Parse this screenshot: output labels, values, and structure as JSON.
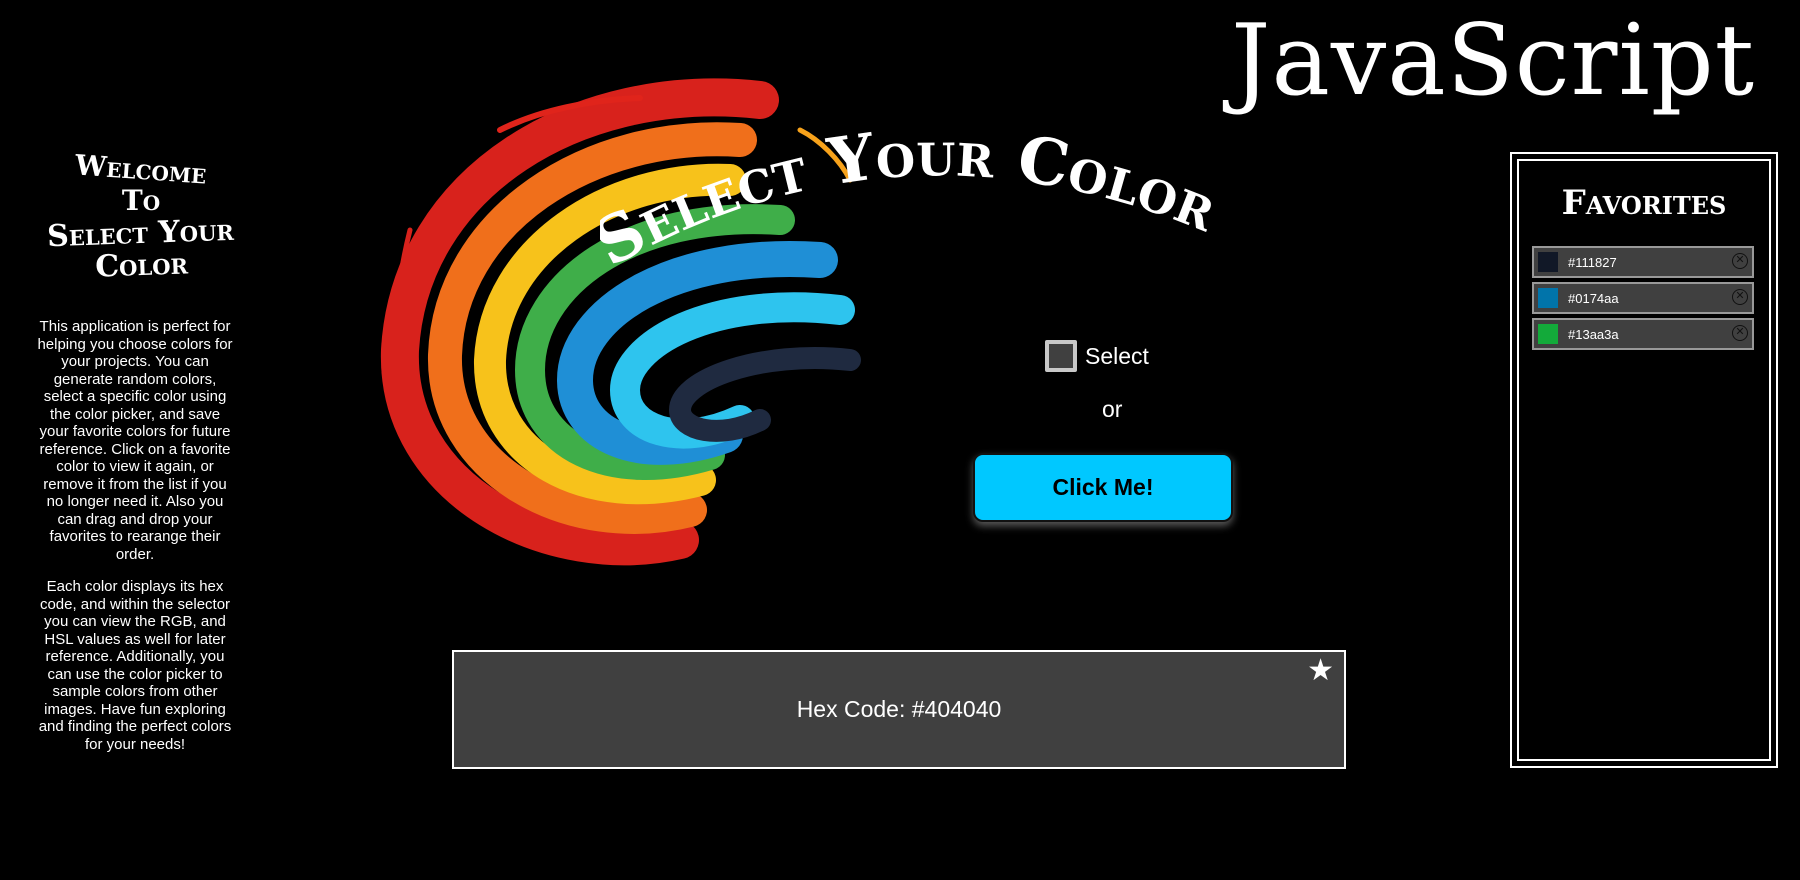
{
  "logo": {
    "text": "JavaScript"
  },
  "welcome": {
    "line1": "Welcome",
    "line2": "To",
    "line3": "Select Your Color",
    "paragraph1": "This application is perfect for helping you choose colors for your projects. You can generate random colors, select a specific color using the color picker, and save your favorite colors for future reference. Click on a favorite color to view it again, or remove it from the list if you no longer need it. Also you can drag and drop your favorites to rearange their order.",
    "paragraph2": "Each color displays its hex code, and within the selector you can view the RGB, and HSL values as well for later reference. Additionally, you can use the color picker to sample colors from other images. Have fun exploring and finding the perfect colors for your needs!"
  },
  "main_title": {
    "text": "Select Your Color"
  },
  "selector": {
    "select_label": "Select",
    "or_label": "or",
    "button_label": "Click Me!",
    "current_color": "#404040"
  },
  "display": {
    "hex_text": "Hex Code: #404040",
    "star_icon": "star-icon"
  },
  "favorites": {
    "title": "Favorites",
    "items": [
      {
        "hex": "#111827",
        "color": "#111827"
      },
      {
        "hex": "#0174aa",
        "color": "#0174aa"
      },
      {
        "hex": "#13aa3a",
        "color": "#13aa3a"
      }
    ],
    "remove_icon": "close-circle-icon"
  }
}
